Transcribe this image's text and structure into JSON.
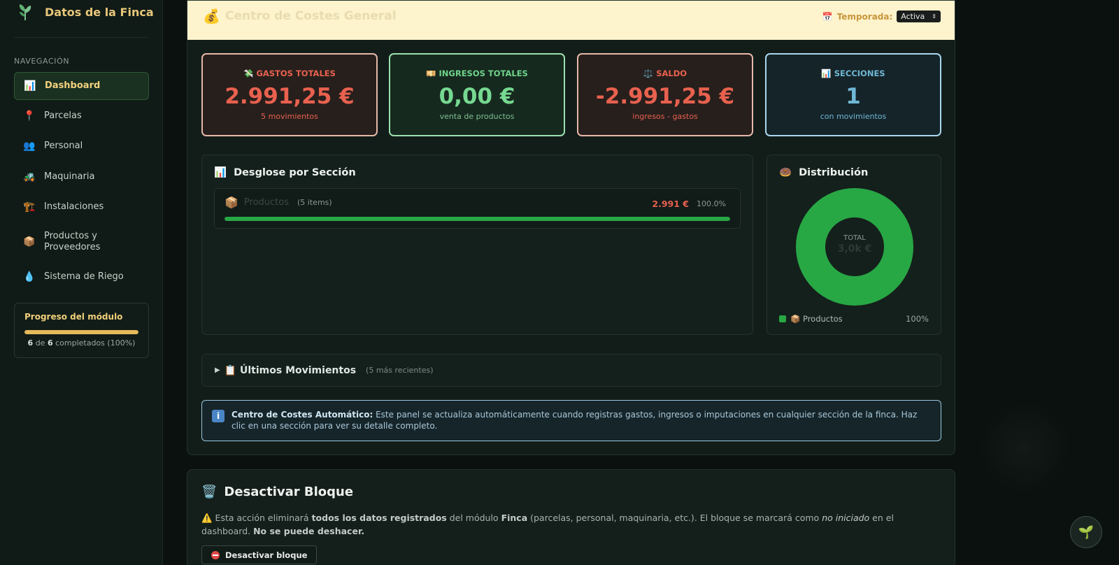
{
  "sidebar": {
    "brand_title": "Datos de la Finca",
    "nav_heading": "NAVEGACIÓN",
    "items": [
      {
        "label": "Dashboard",
        "icon": "📊"
      },
      {
        "label": "Parcelas",
        "icon": "📍"
      },
      {
        "label": "Personal",
        "icon": "👥"
      },
      {
        "label": "Maquinaria",
        "icon": "🚜"
      },
      {
        "label": "Instalaciones",
        "icon": "🏗️"
      },
      {
        "label": "Productos y Proveedores",
        "icon": "📦"
      },
      {
        "label": "Sistema de Riego",
        "icon": "💧"
      }
    ],
    "progress": {
      "title": "Progreso del módulo",
      "done": "6",
      "of": "de",
      "total": "6",
      "suffix": "completados (100%)",
      "fraction": 1.0
    }
  },
  "header": {
    "icon": "💰",
    "title": "Centro de Costes General",
    "temporada_icon": "📅",
    "temporada_label": "Temporada:",
    "temporada_value": "Activa"
  },
  "stats": [
    {
      "icon": "💸",
      "label": "GASTOS TOTALES",
      "value": "2.991,25 €",
      "sub": "5 movimientos",
      "tone": "red"
    },
    {
      "icon": "💴",
      "label": "INGRESOS TOTALES",
      "value": "0,00 €",
      "sub": "venta de productos",
      "tone": "green"
    },
    {
      "icon": "⚖️",
      "label": "SALDO",
      "value": "-2.991,25 €",
      "sub": "ingresos - gastos",
      "tone": "red"
    },
    {
      "icon": "📊",
      "label": "SECCIONES",
      "value": "1",
      "sub": "con movimientos",
      "tone": "blue"
    }
  ],
  "breakdown": {
    "icon": "📊",
    "title": "Desglose por Sección",
    "rows": [
      {
        "icon": "📦",
        "name": "Productos",
        "items": "(5 items)",
        "amount": "2.991 €",
        "percent": "100.0%",
        "fraction": 1.0
      }
    ]
  },
  "distribution": {
    "icon": "🍩",
    "title": "Distribución",
    "center_label": "TOTAL",
    "center_value": "3,0k €",
    "legend": [
      {
        "label": "📦 Productos",
        "percent": "100%",
        "color": "#28a745"
      }
    ]
  },
  "movements": {
    "toggle": "▶",
    "title": "📋 Últimos Movimientos",
    "subtitle": "(5 más recientes)"
  },
  "info": {
    "icon": "i",
    "bold": "Centro de Costes Automático:",
    "text": " Este panel se actualiza automáticamente cuando registras gastos, ingresos o imputaciones en cualquier sección de la finca. Haz clic en una sección para ver su detalle completo."
  },
  "deactivate": {
    "icon": "🗑️",
    "title": "Desactivar Bloque",
    "warn_icon": "⚠️",
    "t1": " Esta acción eliminará ",
    "b1": "todos los datos registrados",
    "t2": " del módulo ",
    "b2": "Finca",
    "t3": " (parcelas, personal, maquinaria, etc.). El bloque se marcará como ",
    "i1": "no iniciado",
    "t4": " en el dashboard. ",
    "b3": "No se puede deshacer.",
    "button_label": "Desactivar bloque"
  },
  "fab_icon": "🌱"
}
